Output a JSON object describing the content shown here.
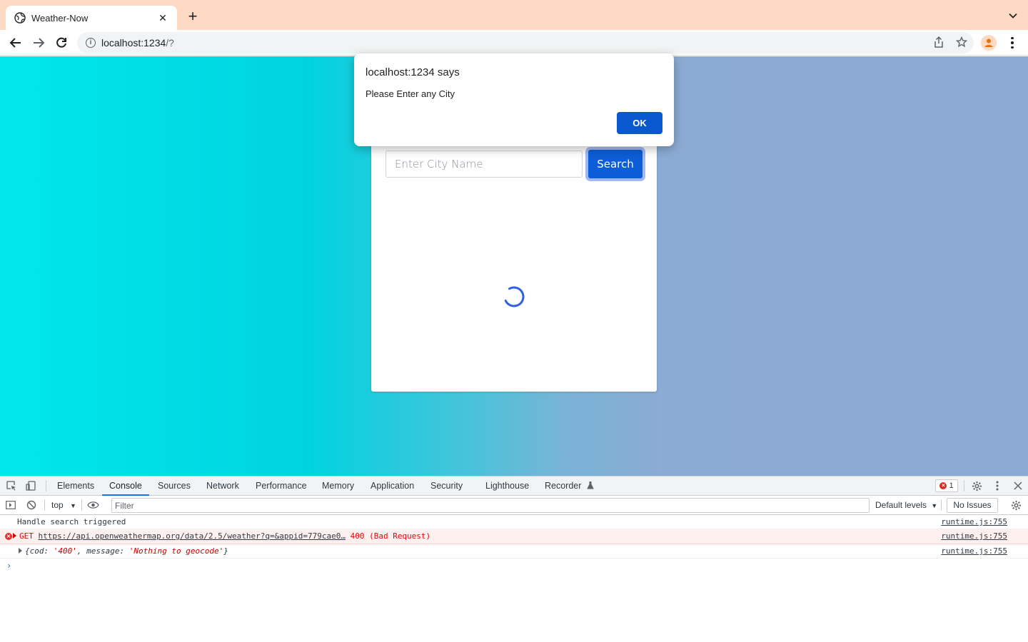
{
  "browser": {
    "tab_title": "Weather-Now",
    "tab_close": "✕",
    "new_tab": "+",
    "url_host": "localhost:1234",
    "url_rest": "/?"
  },
  "alert": {
    "title": "localhost:1234 says",
    "message": "Please Enter any City",
    "ok_label": "OK"
  },
  "app": {
    "input_placeholder": "Enter City Name",
    "search_label": "Search"
  },
  "devtools": {
    "tabs": [
      "Elements",
      "Console",
      "Sources",
      "Network",
      "Performance",
      "Memory",
      "Application",
      "Security",
      "Lighthouse",
      "Recorder"
    ],
    "active_tab": "Console",
    "error_count": "1",
    "context": "top",
    "filter_placeholder": "Filter",
    "levels": "Default levels",
    "issues": "No Issues",
    "logs": [
      {
        "text": "Handle search triggered",
        "source": "runtime.js:755"
      },
      {
        "method": "GET",
        "url": "https://api.openweathermap.org/data/2.5/weather?q=&appid=779cae0…",
        "status": "400 (Bad Request)",
        "source": "runtime.js:755"
      },
      {
        "obj_open": "{",
        "k1": "cod",
        "v1": "'400'",
        "k2": "message",
        "v2": "'Nothing to geocode'",
        "obj_close": "}",
        "source": "runtime.js:755"
      }
    ]
  },
  "colors": {
    "chrome_tabstrip": "#fedac5",
    "accent_blue": "#0b5ed7",
    "gradient_left": "#00e8ea",
    "gradient_right": "#8ca9d3"
  }
}
